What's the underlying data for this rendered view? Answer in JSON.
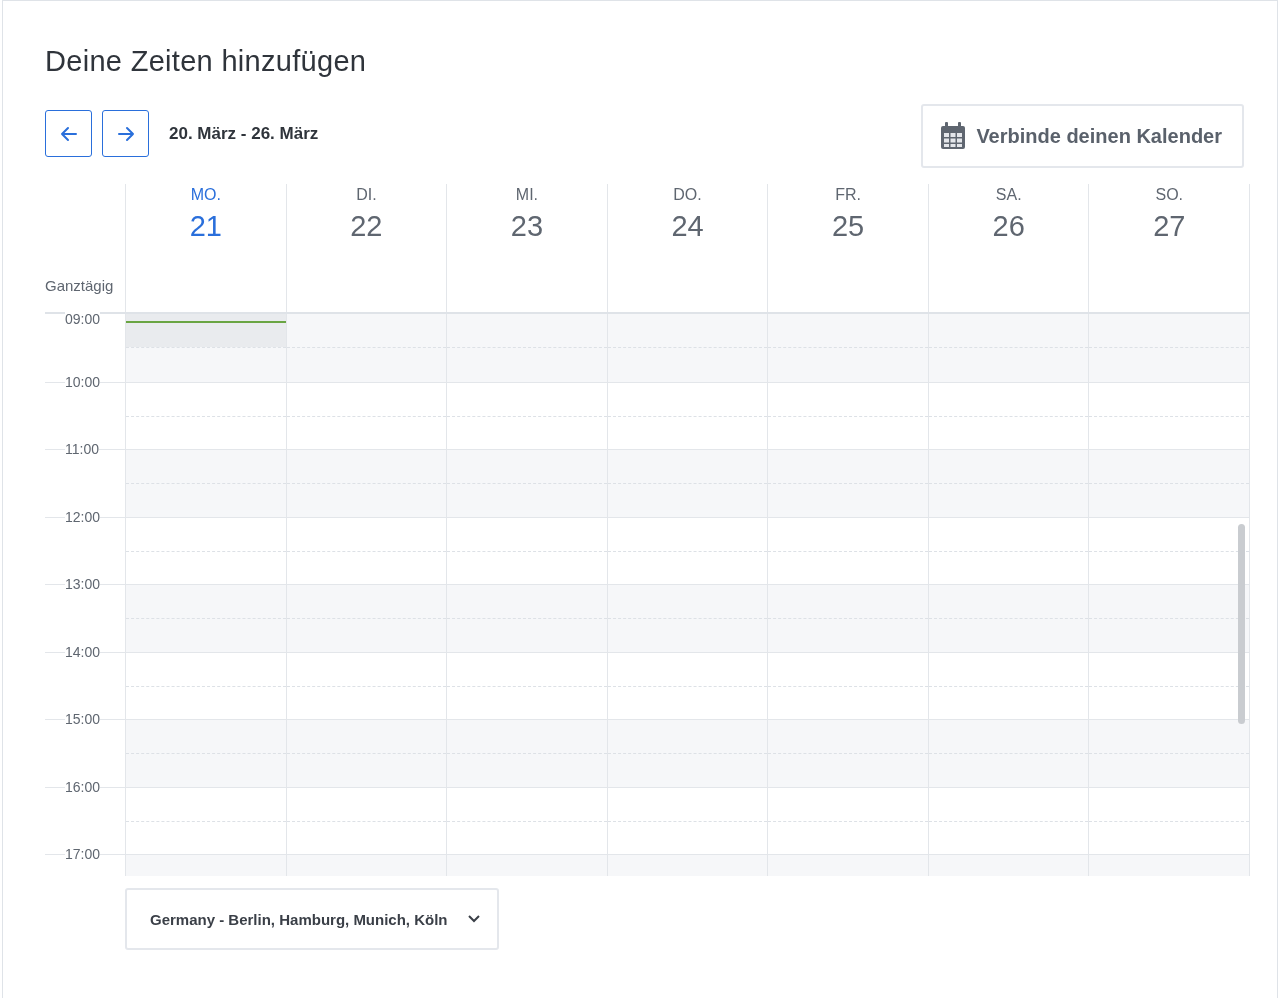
{
  "title": "Deine Zeiten hinzufügen",
  "nav": {
    "date_range": "20. März - 26. März"
  },
  "connect_button": {
    "label": "Verbinde deinen Kalender"
  },
  "days": [
    {
      "weekday": "MO.",
      "date": "21",
      "selected": true
    },
    {
      "weekday": "DI.",
      "date": "22",
      "selected": false
    },
    {
      "weekday": "MI.",
      "date": "23",
      "selected": false
    },
    {
      "weekday": "DO.",
      "date": "24",
      "selected": false
    },
    {
      "weekday": "FR.",
      "date": "25",
      "selected": false
    },
    {
      "weekday": "SA.",
      "date": "26",
      "selected": false
    },
    {
      "weekday": "SO.",
      "date": "27",
      "selected": false
    }
  ],
  "all_day_label": "Ganztägig",
  "hours": [
    "09:00",
    "10:00",
    "11:00",
    "12:00",
    "13:00",
    "14:00",
    "15:00",
    "16:00",
    "17:00"
  ],
  "timezone": {
    "value": "Germany - Berlin, Hamburg, Munich, Köln"
  }
}
